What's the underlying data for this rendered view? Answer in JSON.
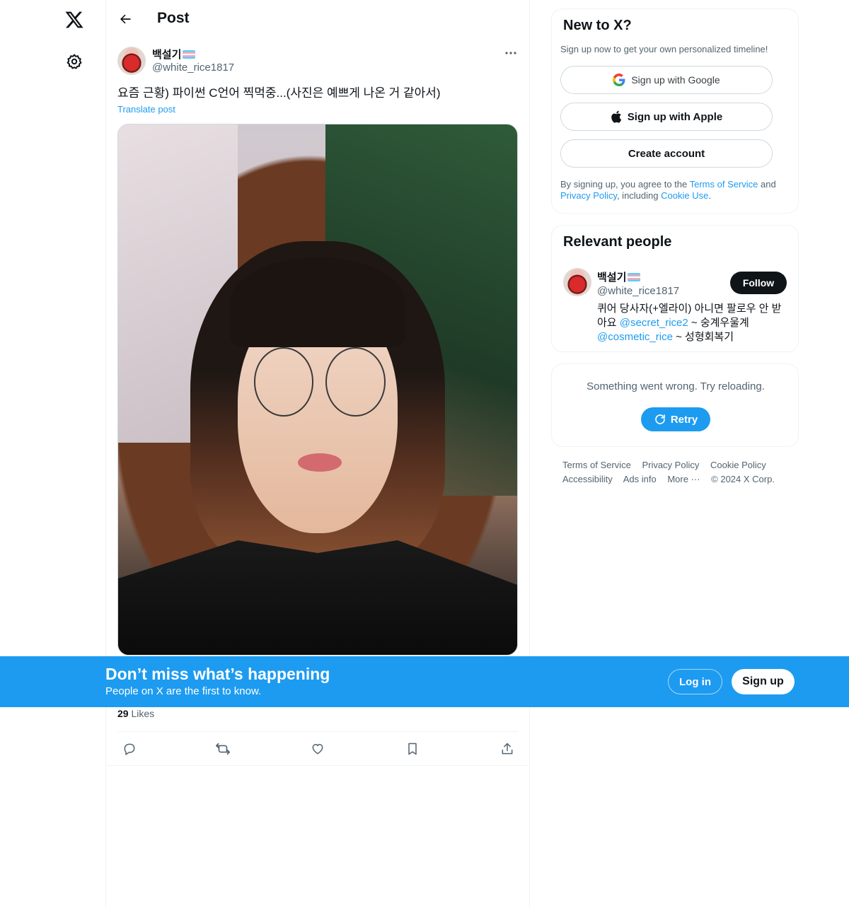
{
  "nav": {
    "logo_icon": "x-logo-icon",
    "settings_icon": "gear-icon"
  },
  "header": {
    "back_icon": "arrow-left-icon",
    "title": "Post"
  },
  "post": {
    "author_name": "백설기",
    "author_handle": "@white_rice1817",
    "text": "요즘 근황) 파이썬 C언어 찍먹중...(사진은 예쁘게 나온 거 같아서)",
    "translate_label": "Translate post",
    "likes_count": "29",
    "likes_label": "Likes"
  },
  "actions": [
    "reply-icon",
    "repost-icon",
    "like-icon",
    "bookmark-icon",
    "share-icon"
  ],
  "signup_card": {
    "title": "New to X?",
    "subtitle": "Sign up now to get your own personalized timeline!",
    "google_label": "Sign up with Google",
    "apple_label": "Sign up with Apple",
    "create_label": "Create account",
    "legal_prefix": "By signing up, you agree to the ",
    "terms_link": "Terms of Service",
    "legal_and": " and ",
    "privacy_link": "Privacy Policy",
    "legal_including": ", including ",
    "cookie_link": "Cookie Use",
    "legal_end": "."
  },
  "relevant_people": {
    "title": "Relevant people",
    "name": "백설기",
    "handle": "@white_rice1817",
    "follow_label": "Follow",
    "bio_1": "퀴어 당사자(+엘라이) 아니면 팔로우 안 받아요 ",
    "bio_mention_1": "@secret_rice2",
    "bio_2": " ~ 숭계우울계 ",
    "bio_mention_2": "@cosmetic_rice",
    "bio_3": " ~ 성형회복기"
  },
  "error_card": {
    "message": "Something went wrong. Try reloading.",
    "retry_label": "Retry"
  },
  "footer": {
    "links": [
      "Terms of Service",
      "Privacy Policy",
      "Cookie Policy",
      "Accessibility",
      "Ads info",
      "More ···",
      "© 2024 X Corp."
    ]
  },
  "banner": {
    "title": "Don’t miss what’s happening",
    "subtitle": "People on X are the first to know.",
    "login_label": "Log in",
    "signup_label": "Sign up"
  },
  "colors": {
    "accent": "#1d9bf0",
    "text_primary": "#0f1419",
    "text_secondary": "#536471"
  }
}
